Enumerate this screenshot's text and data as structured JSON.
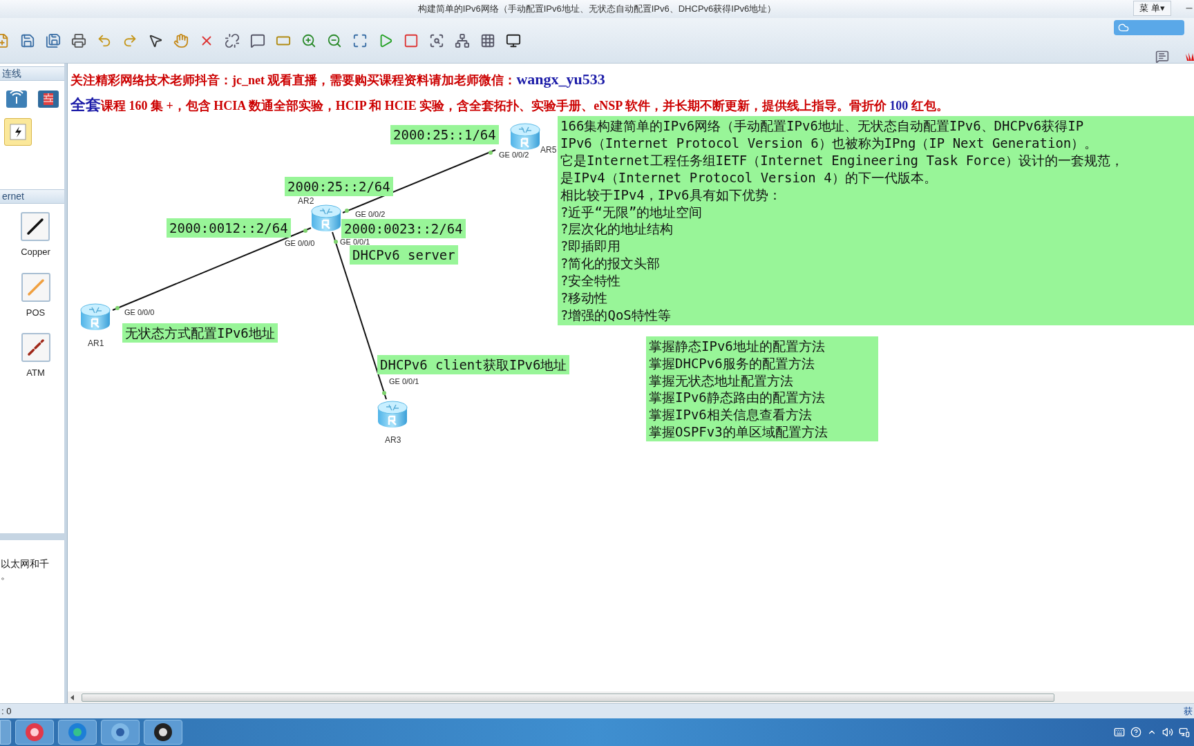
{
  "window": {
    "title": "构建简单的IPv6网络（手动配置IPv6地址、无状态自动配置IPv6、DHCPv6获得IPv6地址）",
    "menu": "菜 单▾"
  },
  "sidebar": {
    "sections": [
      {
        "title": "连线",
        "items": [
          {
            "kind": "wireless",
            "selected": false
          },
          {
            "kind": "firewall",
            "selected": false
          },
          {
            "kind": "auto",
            "selected": true
          }
        ]
      },
      {
        "title": "ernet",
        "items": [
          {
            "kind": "copper",
            "label": "Copper",
            "selected": false
          },
          {
            "kind": "pos",
            "label": "POS",
            "selected": false
          },
          {
            "kind": "atm",
            "label": "ATM",
            "selected": false
          }
        ]
      }
    ],
    "description": [
      "以太网和千",
      "。"
    ]
  },
  "banner": [
    {
      "parts": [
        {
          "text": "关注精彩网络技术老师抖音：jc_net 观看直播，需要购买课程资料请加老师微信：",
          "color": "#cc0000",
          "kind": "normal"
        },
        {
          "text": "wangx_yu533",
          "color": "#1c1ca8",
          "kind": "large"
        }
      ]
    },
    {
      "parts": [
        {
          "text": "全套",
          "color": "#1c1ca8",
          "kind": "large"
        },
        {
          "text": "课程 160 集 +，包含 HCIA 数通全部实验，HCIP 和 HCIE 实验，含全套拓扑、实验手册、eNSP 软件，并长期不断更新，提供线上指导。骨折价 ",
          "color": "#cc0000",
          "kind": "normal"
        },
        {
          "text": "100",
          "color": "#1c1ca8",
          "kind": "normal"
        },
        {
          "text": " 红包。",
          "color": "#cc0000",
          "kind": "normal"
        }
      ]
    }
  ],
  "topology": {
    "devices": [
      {
        "name": "AR5"
      },
      {
        "name": "AR2"
      },
      {
        "name": "AR1"
      },
      {
        "name": "AR3"
      }
    ],
    "ports": [
      {
        "label": "GE 0/0/2"
      },
      {
        "label": "GE 0/0/2"
      },
      {
        "label": "GE 0/0/0"
      },
      {
        "label": "GE 0/0/1"
      },
      {
        "label": "GE 0/0/0"
      },
      {
        "label": "GE 0/0/1"
      }
    ],
    "labels": [
      {
        "text": "2000:25::1/64"
      },
      {
        "text": "2000:25::2/64"
      },
      {
        "text": "2000:0012::2/64"
      },
      {
        "text": "2000:0023::2/64"
      },
      {
        "text": "DHCPv6 server"
      },
      {
        "text": "无状态方式配置IPv6地址"
      },
      {
        "text": "DHCPv6 client获取IPv6地址"
      }
    ],
    "description": [
      "166集构建简单的IPv6网络（手动配置IPv6地址、无状态自动配置IPv6、DHCPv6获得IP",
      "IPv6（Internet Protocol Version 6）也被称为IPng（IP Next Generation）。",
      "它是Internet工程任务组IETF（Internet Engineering Task Force）设计的一套规范，",
      "是IPv4（Internet Protocol Version 4）的下一代版本。",
      "相比较于IPv4，IPv6具有如下优势：",
      "?近乎“无限”的地址空间",
      "?层次化的地址结构",
      "?即插即用",
      "?简化的报文头部",
      "?安全特性",
      "?移动性",
      "?增强的QoS特性等"
    ],
    "objectives": [
      "掌握静态IPv6地址的配置方法",
      "掌握DHCPv6服务的配置方法",
      "掌握无状态地址配置方法",
      "掌握IPv6静态路由的配置方法",
      "掌握IPv6相关信息查看方法",
      "掌握OSPFv3的单区域配置方法"
    ]
  },
  "status_bar": {
    "left": ": 0",
    "right": "获"
  }
}
